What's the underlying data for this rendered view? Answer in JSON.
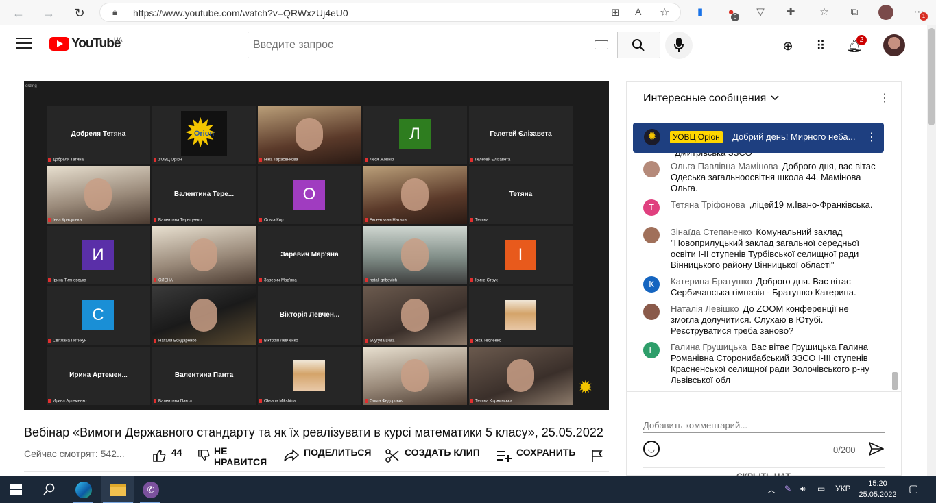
{
  "browser": {
    "url": "https://www.youtube.com/watch?v=QRWxzUj4eU0",
    "ext_badge_count": "6",
    "notif_badge": "1"
  },
  "header": {
    "logo_text": "YouTube",
    "region": "UA",
    "search_placeholder": "Введите запрос",
    "notification_count": "2"
  },
  "player": {
    "recording_label": "ording",
    "tiles": [
      {
        "row": 0,
        "col": 0,
        "kind": "name",
        "center": "Добреля Тетяна",
        "label": "Добреля Тетяна"
      },
      {
        "row": 0,
        "col": 1,
        "kind": "logo",
        "center": "Orion",
        "label": "УОВЦ Оріон"
      },
      {
        "row": 0,
        "col": 2,
        "kind": "photo",
        "label": "Ніна Тарасенкова"
      },
      {
        "row": 0,
        "col": 3,
        "kind": "letter",
        "letter": "Л",
        "color": "#2e7d1f",
        "label": "Леся Жовнір"
      },
      {
        "row": 0,
        "col": 4,
        "kind": "name",
        "center": "Гелетей Єлізавета",
        "label": "Гелетей Єлізавета"
      },
      {
        "row": 1,
        "col": 0,
        "kind": "photo",
        "label": "Інна Красуцька",
        "active": true
      },
      {
        "row": 1,
        "col": 1,
        "kind": "name",
        "center": "Валентина Тере...",
        "label": "Валентина Терещенко"
      },
      {
        "row": 1,
        "col": 2,
        "kind": "letter",
        "letter": "О",
        "color": "#a03cc0",
        "label": "Ольга Кир"
      },
      {
        "row": 1,
        "col": 3,
        "kind": "photo",
        "label": "Аксентьєва Наталя"
      },
      {
        "row": 1,
        "col": 4,
        "kind": "name",
        "center": "Тетяна",
        "label": "Тетяна"
      },
      {
        "row": 2,
        "col": 0,
        "kind": "letter",
        "letter": "И",
        "color": "#5a2fa8",
        "label": "Ірина Типневська"
      },
      {
        "row": 2,
        "col": 1,
        "kind": "photo",
        "label": "ОЛЕНА"
      },
      {
        "row": 2,
        "col": 2,
        "kind": "name",
        "center": "Заревич Мар'яна",
        "label": "Заревич Мар'яна"
      },
      {
        "row": 2,
        "col": 3,
        "kind": "photo",
        "label": "natali gribovich"
      },
      {
        "row": 2,
        "col": 4,
        "kind": "letter",
        "letter": "І",
        "color": "#e85a1c",
        "label": "Ірина Струк"
      },
      {
        "row": 3,
        "col": 0,
        "kind": "letter",
        "letter": "С",
        "color": "#1a8fd6",
        "label": "Світлана Потикун"
      },
      {
        "row": 3,
        "col": 1,
        "kind": "photo",
        "label": "Наталя Бондаренко"
      },
      {
        "row": 3,
        "col": 2,
        "kind": "name",
        "center": "Вікторія Левчен...",
        "label": "Вікторія Левченко"
      },
      {
        "row": 3,
        "col": 3,
        "kind": "photo",
        "label": "Svyryda Dara"
      },
      {
        "row": 3,
        "col": 4,
        "kind": "smallphoto",
        "label": "Яка Тесленко"
      },
      {
        "row": 4,
        "col": 0,
        "kind": "name",
        "center": "Ирина Артемен...",
        "label": "Ирина Артеменко"
      },
      {
        "row": 4,
        "col": 1,
        "kind": "name",
        "center": "Валентина Панта",
        "label": "Валентина Панта"
      },
      {
        "row": 4,
        "col": 2,
        "kind": "smallphoto",
        "label": "Oksana Mikshina"
      },
      {
        "row": 4,
        "col": 3,
        "kind": "photo",
        "label": "Ольга Федорович"
      },
      {
        "row": 4,
        "col": 4,
        "kind": "photo",
        "label": "Тетяна Коржинська"
      }
    ]
  },
  "video": {
    "title": "Вебінар «Вимоги Державного стандарту та як їх реалізувати в курсі математики 5 класу», 25.05.2022",
    "viewers": "Сейчас смотрят: 542...",
    "likes": "44",
    "dislike_label_1": "НЕ",
    "dislike_label_2": "НРАВИТСЯ",
    "share_label": "ПОДЕЛИТЬСЯ",
    "clip_label": "СОЗДАТЬ КЛИП",
    "save_label": "СОХРАНИТЬ"
  },
  "chat": {
    "title": "Интересные сообщения",
    "pinned_author": "УОВЦ Оріон",
    "pinned_text": "Добрий день! Мирного неба...",
    "partial_line": "Дмитрівська ЗЗСО",
    "messages": [
      {
        "initial": "",
        "color": "#b58a7a",
        "author": "Ольга Павлівна Мамінова",
        "text": "Доброго дня, вас вітає Одеська загальноосвітня школа 44. Мамінова Ольга."
      },
      {
        "initial": "Т",
        "color": "#e0407f",
        "author": "Тетяна Тріфонова",
        "text": ",ліцей19 м.Івано-Франківська."
      },
      {
        "initial": "",
        "color": "#a0705a",
        "author": "Зінаїда Степаненко",
        "text": "Комунальний заклад \"Новоприлуцький заклад загальної середньої освіти І-ІІ ступенів Турбівської селищної ради Вінницького району Вінницької області\""
      },
      {
        "initial": "К",
        "color": "#1565c0",
        "author": "Катерина Братушко",
        "text": "Доброго дня. Вас вітає Сербичанська гімназія - Братушко Катерина."
      },
      {
        "initial": "",
        "color": "#8a5a4a",
        "author": "Наталія Левішко",
        "text": "До ZOOM конференції не змогла долучитися. Слухаю в Ютубі. Реєструватися треба заново?"
      },
      {
        "initial": "Г",
        "color": "#2e9e6a",
        "author": "Галина Грушицька",
        "text": "Вас вітає Грушицька Галина Романівна Сторонибабський ЗЗСО І-ІІІ ступенів Красненської селищної ради Золочівського р-ну Львівської обл"
      }
    ],
    "comment_placeholder": "Добавить комментарий...",
    "char_count": "0/200",
    "hide_chat": "СКРЫТЬ ЧАТ"
  },
  "taskbar": {
    "lang": "УКР",
    "time": "15:20",
    "date": "25.05.2022"
  }
}
